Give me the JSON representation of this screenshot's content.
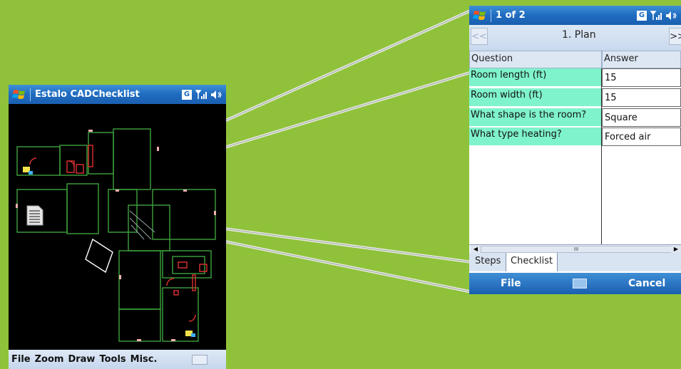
{
  "colors": {
    "background": "#8fc23a",
    "title_bar": "#1f6cc0",
    "question_cell": "#7ff3cb",
    "cad_walls": "#3ea33e",
    "cad_doors": "#e03030"
  },
  "left_window": {
    "title": "Estalo CADChecklist",
    "status_icons": [
      "google-icon",
      "signal-icon",
      "volume-icon"
    ],
    "menu": [
      "File",
      "Zoom",
      "Draw",
      "Tools",
      "Misc."
    ],
    "drawing_icon": "document-icon"
  },
  "right_window": {
    "title": "1 of 2",
    "nav": {
      "prev": "<<",
      "next": ">>",
      "title": "1. Plan"
    },
    "table": {
      "headers": [
        "Question",
        "Answer"
      ],
      "rows": [
        {
          "question": "Room length (ft)",
          "answer": "15"
        },
        {
          "question": "Room width (ft)",
          "answer": "15"
        },
        {
          "question": "What shape is the room?",
          "answer": "Square"
        },
        {
          "question": "What type heating?",
          "answer": "Forced air"
        }
      ]
    },
    "scrollbar_thumb": "III",
    "tabs": [
      "Steps",
      "Checklist"
    ],
    "active_tab": "Checklist",
    "softkeys": {
      "left": "File",
      "right": "Cancel"
    }
  }
}
